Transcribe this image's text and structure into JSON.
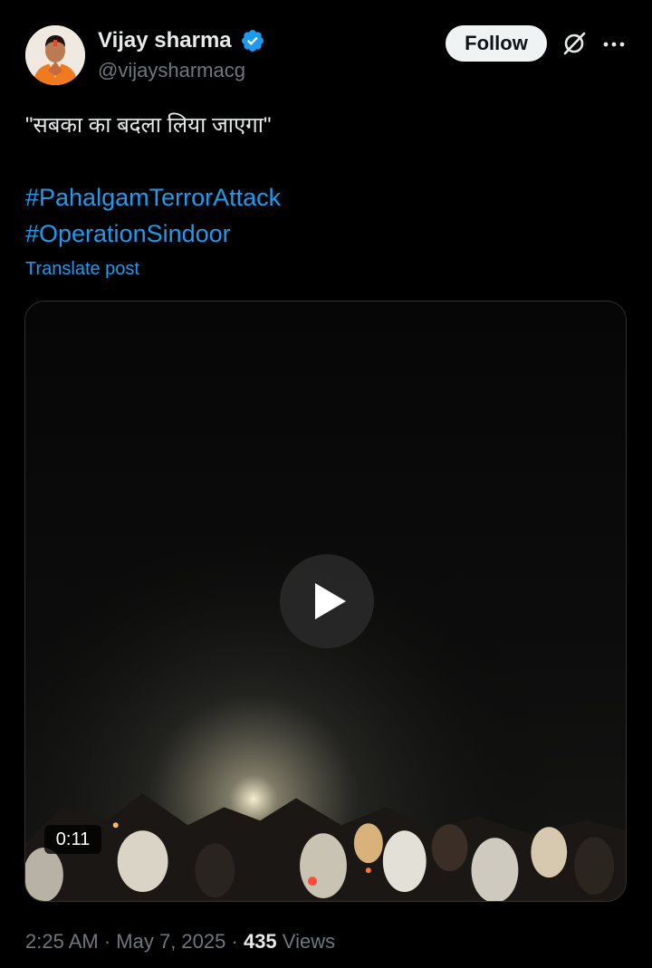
{
  "author": {
    "name": "Vijay sharma",
    "handle": "@vijaysharmacg",
    "verified": true,
    "avatar_icon": "avatar"
  },
  "header": {
    "follow_label": "Follow",
    "grok_icon": "grok-icon",
    "more_icon": "more-icon"
  },
  "post": {
    "text": "\"सबका का बदला लिया जाएगा\"",
    "hashtags": [
      "#PahalgamTerrorAttack",
      "#OperationSindoor"
    ],
    "translate_label": "Translate post"
  },
  "media": {
    "type": "video",
    "duration": "0:11",
    "play_icon": "play-icon"
  },
  "meta": {
    "time": "2:25 AM",
    "separator": "·",
    "date": "May 7, 2025",
    "views_count": "435",
    "views_label": "Views"
  },
  "colors": {
    "background": "#000000",
    "text": "#e7e9ea",
    "secondary": "#71767b",
    "link": "#1d9bf0",
    "verified": "#1d9bf0",
    "follow_bg": "#eff3f4"
  }
}
